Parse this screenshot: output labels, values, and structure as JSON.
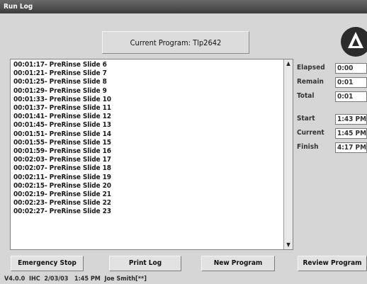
{
  "window": {
    "title": "Run Log"
  },
  "program": {
    "text": "Current Program:  Tlp2642"
  },
  "log": {
    "lines": [
      "00:01:17- PreRinse Slide 6",
      "00:01:21- PreRinse Slide 7",
      "00:01:25- PreRinse Slide 8",
      "00:01:29- PreRinse Slide 9",
      "00:01:33- PreRinse Slide 10",
      "00:01:37- PreRinse Slide 11",
      "00:01:41- PreRinse Slide 12",
      "00:01:45- PreRinse Slide 13",
      "00:01:51- PreRinse Slide 14",
      "00:01:55- PreRinse Slide 15",
      "00:01:59- PreRinse Slide 16",
      "00:02:03- PreRinse Slide 17",
      "00:02:07- PreRinse Slide 18",
      "00:02:11- PreRinse Slide 19",
      "00:02:15- PreRinse Slide 20",
      "00:02:19- PreRinse Slide 21",
      "00:02:23- PreRinse Slide 22",
      "00:02:27- PreRinse Slide 23"
    ]
  },
  "stats": {
    "elapsed": {
      "label": "Elapsed",
      "value": "0:00"
    },
    "remain": {
      "label": "Remain",
      "value": "0:01"
    },
    "total": {
      "label": "Total",
      "value": "0:01"
    },
    "start": {
      "label": "Start",
      "value": "1:43 PM"
    },
    "current": {
      "label": "Current",
      "value": "1:45 PM"
    },
    "finish": {
      "label": "Finish",
      "value": "4:17 PM"
    }
  },
  "buttons": {
    "emergency_stop": "Emergency Stop",
    "print_log": "Print Log",
    "new_program": "New Program",
    "review_program": "Review Program"
  },
  "status": {
    "version": "V4.0.0",
    "mode": "IHC",
    "date": "2/03/03",
    "time": "1:45 PM",
    "user": "Joe Smith[**]"
  },
  "icons": {
    "logo": "logo-icon",
    "scroll_up": "scroll-up-arrow-icon",
    "scroll_down": "scroll-down-arrow-icon"
  },
  "colors": {
    "titlebar": "#4a4a4a",
    "background": "#d6d6d6",
    "log_background": "#ffffff"
  }
}
